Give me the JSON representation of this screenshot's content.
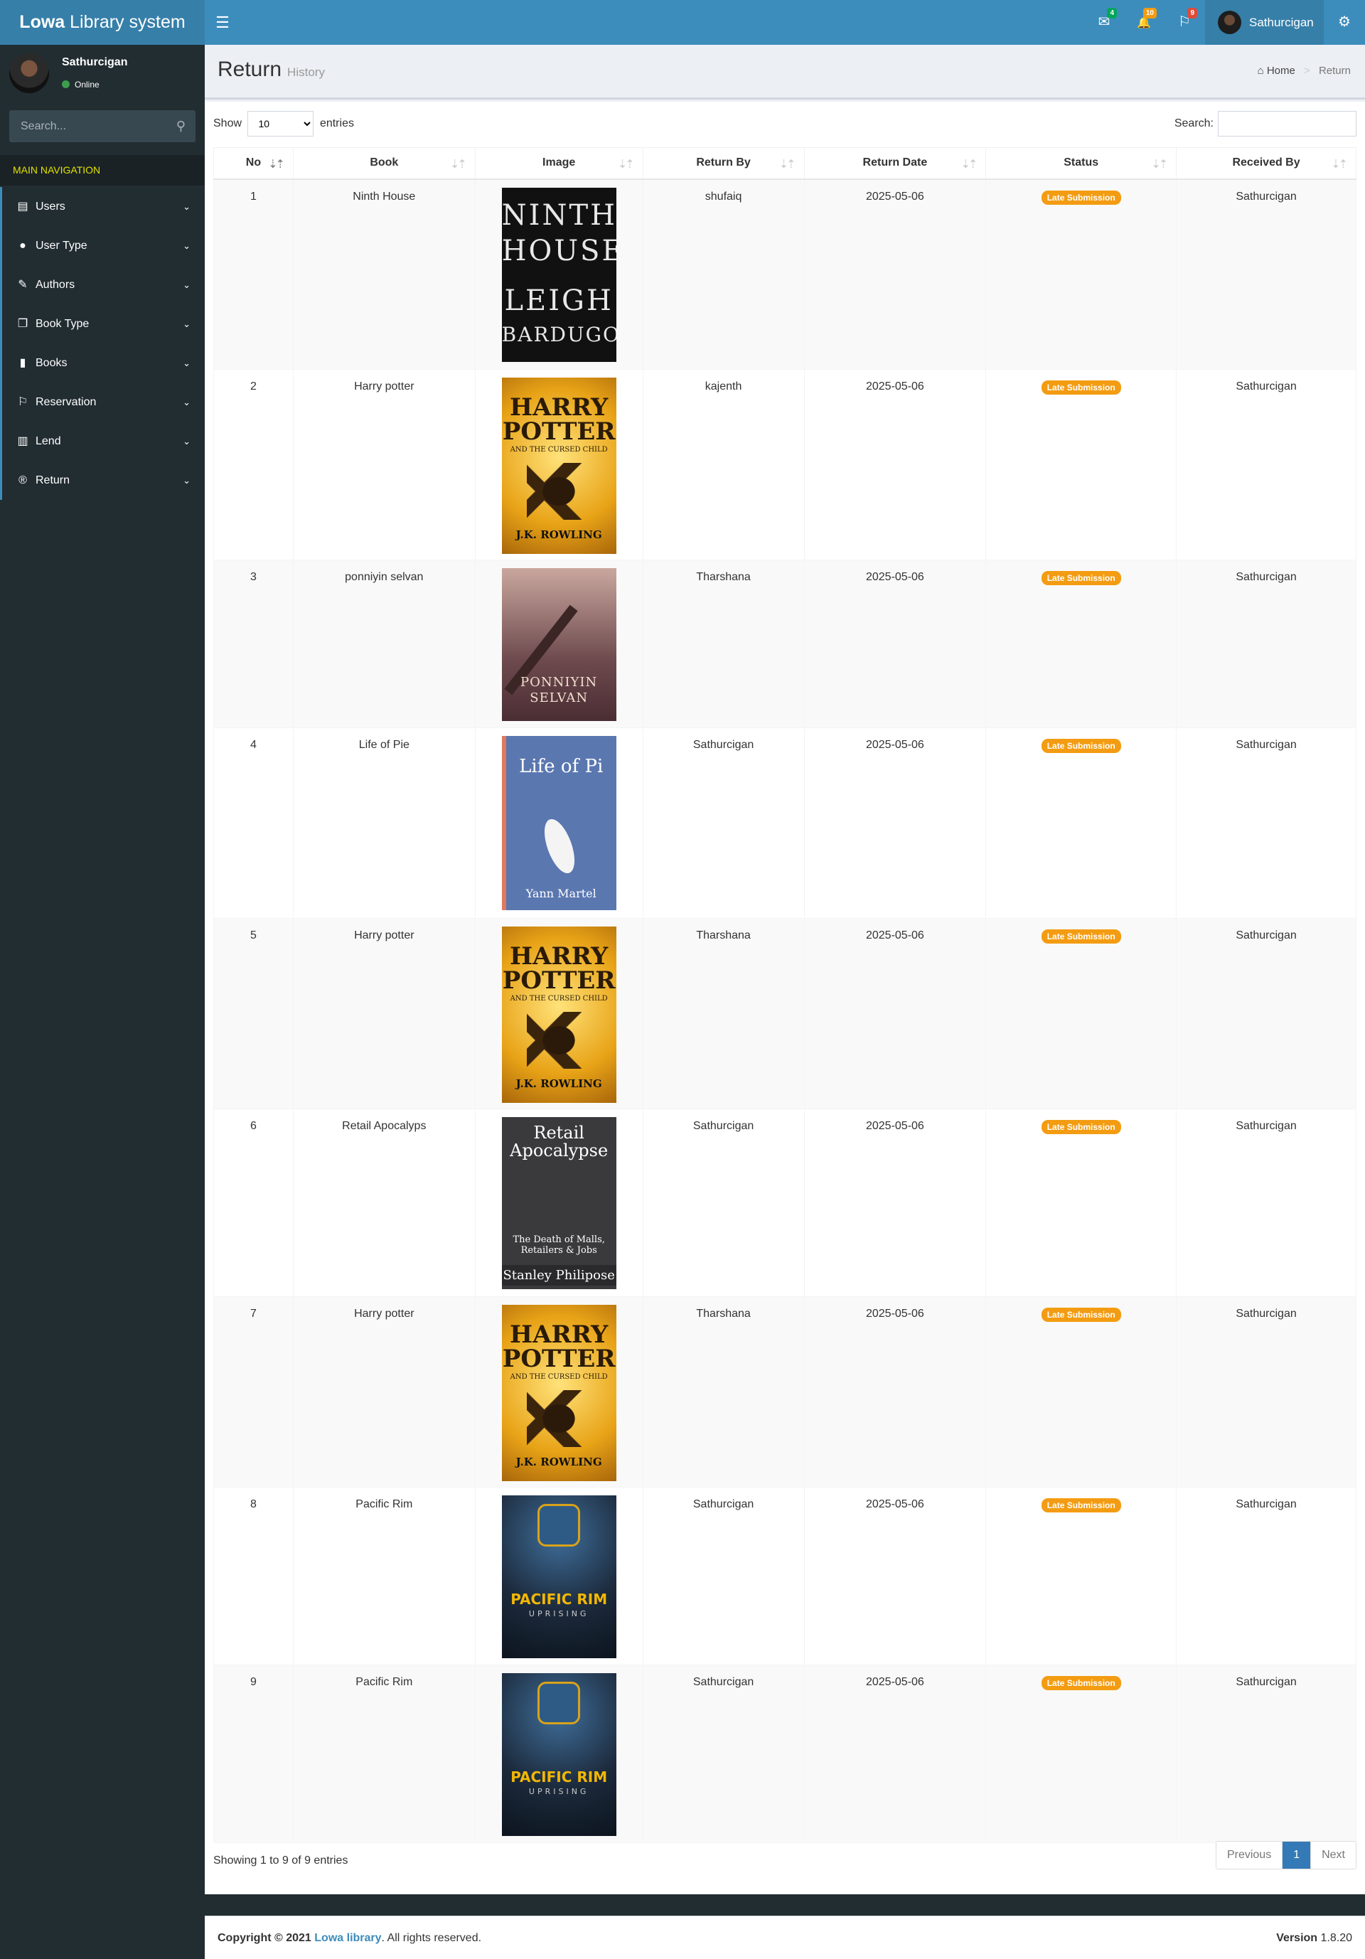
{
  "app": {
    "logo_bold": "Lowa",
    "logo_rest": " Library system"
  },
  "header": {
    "toggle_icon": "☰",
    "messages": {
      "icon": "envelope-icon",
      "glyph": "✉",
      "count": "4",
      "color": "#00a65a"
    },
    "notifications": {
      "icon": "bell-icon",
      "glyph": "🔔",
      "count": "10",
      "color": "#f39c12"
    },
    "tasks": {
      "icon": "flag-icon",
      "glyph": "⚐",
      "count": "9",
      "color": "#dd4b39"
    },
    "user_name": "Sathurcigan",
    "gears_glyph": "⚙"
  },
  "sidebar": {
    "user_name": "Sathurcigan",
    "status": "Online",
    "search_placeholder": "Search...",
    "nav_header": "MAIN NAVIGATION",
    "items": [
      {
        "label": "Users",
        "icon": "id-card-icon",
        "glyph": "▤"
      },
      {
        "label": "User Type",
        "icon": "user-circle-icon",
        "glyph": "●"
      },
      {
        "label": "Authors",
        "icon": "edit-icon",
        "glyph": "✎"
      },
      {
        "label": "Book Type",
        "icon": "copy-icon",
        "glyph": "❐"
      },
      {
        "label": "Books",
        "icon": "book-icon",
        "glyph": "▮"
      },
      {
        "label": "Reservation",
        "icon": "flag-icon",
        "glyph": "⚐"
      },
      {
        "label": "Lend",
        "icon": "open-book-icon",
        "glyph": "▥"
      },
      {
        "label": "Return",
        "icon": "registered-icon",
        "glyph": "®"
      }
    ]
  },
  "page": {
    "title": "Return",
    "subtitle": "History",
    "breadcrumb": [
      "Home",
      "Return"
    ]
  },
  "table_controls": {
    "show": "Show",
    "length": "10",
    "entries": "entries",
    "search_label": "Search:"
  },
  "table": {
    "columns": [
      "No",
      "Book",
      "Image",
      "Return By",
      "Return Date",
      "Status",
      "Received By"
    ],
    "rows": [
      {
        "no": "1",
        "book": "Ninth House",
        "return_by": "shufaiq",
        "date": "2025-05-06",
        "status": "Late Submission",
        "received_by": "Sathurcigan",
        "cover": {
          "lines": [
            "NINTH",
            "HOUSE",
            "LEIGH",
            "BARDUGO"
          ],
          "bg": "#111111",
          "fg": "#e8e8e8"
        }
      },
      {
        "no": "2",
        "book": "Harry potter",
        "return_by": "kajenth",
        "date": "2025-05-06",
        "status": "Late Submission",
        "received_by": "Sathurcigan",
        "cover": {
          "lines": [
            "HARRY",
            "POTTER",
            "AND THE CURSED CHILD",
            "J.K. ROWLING"
          ],
          "bg": "#e8a317",
          "fg": "#1a1a1a"
        }
      },
      {
        "no": "3",
        "book": "ponniyin selvan",
        "return_by": "Tharshana",
        "date": "2025-05-06",
        "status": "Late Submission",
        "received_by": "Sathurcigan",
        "cover": {
          "lines": [
            "PONNIYIN",
            "SELVAN"
          ],
          "bg": "#6e4a4e",
          "fg": "#f0e0d0"
        }
      },
      {
        "no": "4",
        "book": "Life of Pie",
        "return_by": "Sathurcigan",
        "date": "2025-05-06",
        "status": "Late Submission",
        "received_by": "Sathurcigan",
        "cover": {
          "lines": [
            "Life of Pi",
            "Yann Martel"
          ],
          "bg": "#5a77b0",
          "fg": "#ffffff"
        }
      },
      {
        "no": "5",
        "book": "Harry potter",
        "return_by": "Tharshana",
        "date": "2025-05-06",
        "status": "Late Submission",
        "received_by": "Sathurcigan",
        "cover": {
          "lines": [
            "HARRY",
            "POTTER",
            "AND THE CURSED CHILD",
            "J.K. ROWLING"
          ],
          "bg": "#e8a317",
          "fg": "#1a1a1a"
        }
      },
      {
        "no": "6",
        "book": "Retail Apocalyps",
        "return_by": "Sathurcigan",
        "date": "2025-05-06",
        "status": "Late Submission",
        "received_by": "Sathurcigan",
        "cover": {
          "lines": [
            "Retail",
            "Apocalypse",
            "The Death of Malls, Retailers & Jobs",
            "Stanley Philipose"
          ],
          "bg": "#3a3a3c",
          "fg": "#ffffff"
        }
      },
      {
        "no": "7",
        "book": "Harry potter",
        "return_by": "Tharshana",
        "date": "2025-05-06",
        "status": "Late Submission",
        "received_by": "Sathurcigan",
        "cover": {
          "lines": [
            "HARRY",
            "POTTER",
            "AND THE CURSED CHILD",
            "J.K. ROWLING"
          ],
          "bg": "#e8a317",
          "fg": "#1a1a1a"
        }
      },
      {
        "no": "8",
        "book": "Pacific Rim",
        "return_by": "Sathurcigan",
        "date": "2025-05-06",
        "status": "Late Submission",
        "received_by": "Sathurcigan",
        "cover": {
          "lines": [
            "PACIFIC RIM",
            "UPRISING"
          ],
          "bg": "#1c2a3c",
          "fg": "#f2b705"
        }
      },
      {
        "no": "9",
        "book": "Pacific Rim",
        "return_by": "Sathurcigan",
        "date": "2025-05-06",
        "status": "Late Submission",
        "received_by": "Sathurcigan",
        "cover": {
          "lines": [
            "PACIFIC RIM",
            "UPRISING"
          ],
          "bg": "#1c2a3c",
          "fg": "#f2b705"
        }
      }
    ]
  },
  "footer_info": "Showing 1 to 9 of 9 entries",
  "pagination": {
    "previous": "Previous",
    "current": "1",
    "next": "Next"
  },
  "footer": {
    "copyright": "Copyright © 2021",
    "link": "Lowa library",
    "rights": ". All rights reserved.",
    "version_label": "Version",
    "version": "1.8.20"
  },
  "colors": {
    "header": "#3c8dbc",
    "sidebar": "#222d32",
    "badge": "#f39c12"
  }
}
